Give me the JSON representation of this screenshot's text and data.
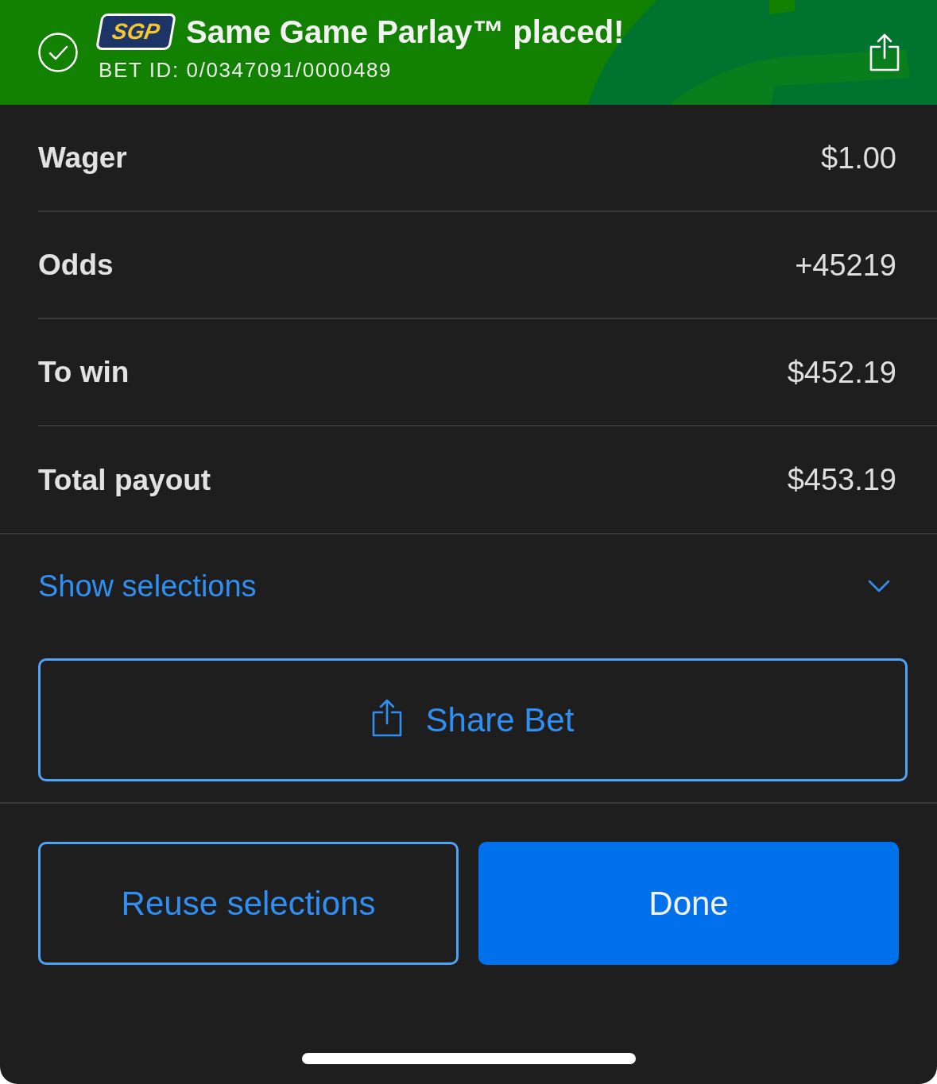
{
  "header": {
    "badge": "SGP",
    "title": "Same Game Parlay™ placed!",
    "bet_id": "BET ID: 0/0347091/0000489"
  },
  "summary": [
    {
      "label": "Wager",
      "value": "$1.00"
    },
    {
      "label": "Odds",
      "value": "+45219"
    },
    {
      "label": "To win",
      "value": "$452.19"
    },
    {
      "label": "Total payout",
      "value": "$453.19"
    }
  ],
  "selections_toggle": {
    "label": "Show selections",
    "expanded": false
  },
  "share_button": {
    "label": "Share Bet"
  },
  "actions": [
    {
      "label": "Reuse selections",
      "kind": "outline"
    },
    {
      "label": "Done",
      "kind": "primary"
    }
  ]
}
